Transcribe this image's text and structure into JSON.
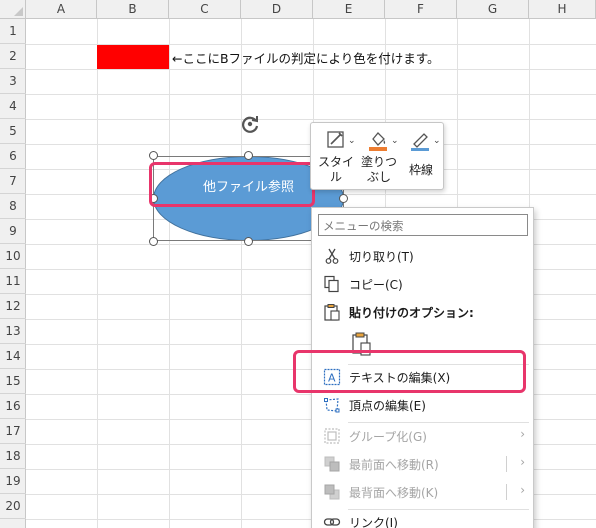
{
  "columns": [
    "A",
    "B",
    "C",
    "D",
    "E",
    "F",
    "G",
    "H"
  ],
  "rows": [
    "1",
    "2",
    "3",
    "4",
    "5",
    "6",
    "7",
    "8",
    "9",
    "10",
    "11",
    "12",
    "13",
    "14",
    "15",
    "16",
    "17",
    "18",
    "19",
    "20"
  ],
  "sheet": {
    "note_text": "←ここにBファイルの判定により色を付けます。",
    "flag_color": "#ff0000"
  },
  "shape": {
    "label": "他ファイル参照",
    "fill": "#5b9bd5"
  },
  "mini_toolbar": {
    "style_label_1": "スタイ",
    "style_label_2": "ル",
    "fill_label_1": "塗りつ",
    "fill_label_2": "ぶし",
    "outline_label": "枠線"
  },
  "context_menu": {
    "search_placeholder": "メニューの検索",
    "items": [
      {
        "label": "切り取り(T)",
        "icon": "scissors-icon",
        "enabled": true
      },
      {
        "label": "コピー(C)",
        "icon": "copy-icon",
        "enabled": true
      },
      {
        "label": "貼り付けのオプション:",
        "icon": "paste-icon",
        "enabled": true
      },
      {
        "label": "テキストの編集(X)",
        "icon": "edit-text-icon",
        "enabled": true
      },
      {
        "label": "頂点の編集(E)",
        "icon": "edit-points-icon",
        "enabled": true
      },
      {
        "label": "グループ化(G)",
        "icon": "group-icon",
        "enabled": false
      },
      {
        "label": "最前面へ移動(R)",
        "icon": "bring-front-icon",
        "enabled": false
      },
      {
        "label": "最背面へ移動(K)",
        "icon": "send-back-icon",
        "enabled": false
      },
      {
        "label": "リンク(I)",
        "icon": "link-icon",
        "enabled": true
      }
    ]
  },
  "highlight_color": "#e8356b"
}
